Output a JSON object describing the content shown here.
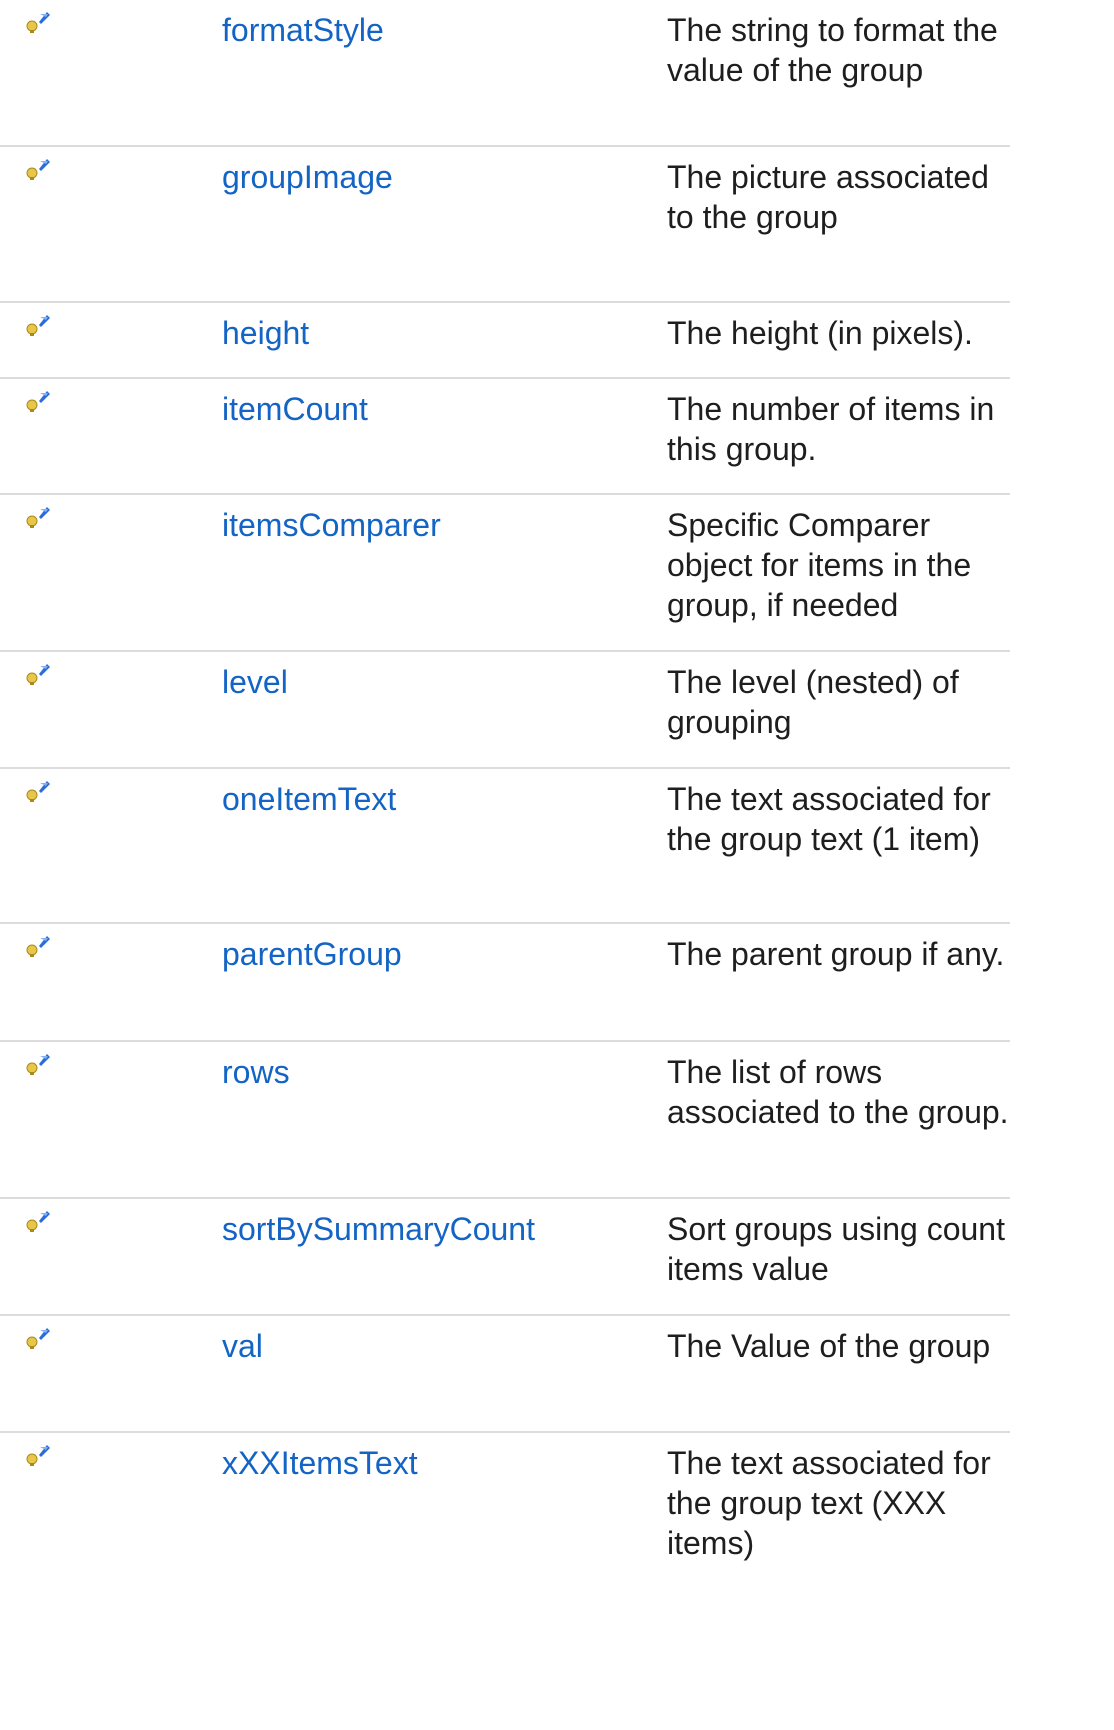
{
  "members": [
    {
      "icon": "public-property-icon",
      "name": "formatStyle",
      "description": "The string to format the value of the group"
    },
    {
      "icon": "public-property-icon",
      "name": "groupImage",
      "description": "The picture associated to the group"
    },
    {
      "icon": "public-property-icon",
      "name": "height",
      "description": "The height (in pixels)."
    },
    {
      "icon": "public-property-icon",
      "name": "itemCount",
      "description": "The number of items in this group."
    },
    {
      "icon": "public-property-icon",
      "name": "itemsComparer",
      "description": "Specific Comparer object for items in the group, if needed"
    },
    {
      "icon": "public-property-icon",
      "name": "level",
      "description": "The level (nested) of grouping"
    },
    {
      "icon": "public-property-icon",
      "name": "oneItemText",
      "description": "The text associated for the group text (1 item)"
    },
    {
      "icon": "public-property-icon",
      "name": "parentGroup",
      "description": "The parent group if any."
    },
    {
      "icon": "public-property-icon",
      "name": "rows",
      "description": "The list of rows associated to the group."
    },
    {
      "icon": "public-property-icon",
      "name": "sortBySummaryCount",
      "description": "Sort groups using count items value"
    },
    {
      "icon": "public-property-icon",
      "name": "val",
      "description": "The Value of the group"
    },
    {
      "icon": "public-property-icon",
      "name": "xXXItemsText",
      "description": "The text associated for the group text (XXX items)"
    }
  ]
}
